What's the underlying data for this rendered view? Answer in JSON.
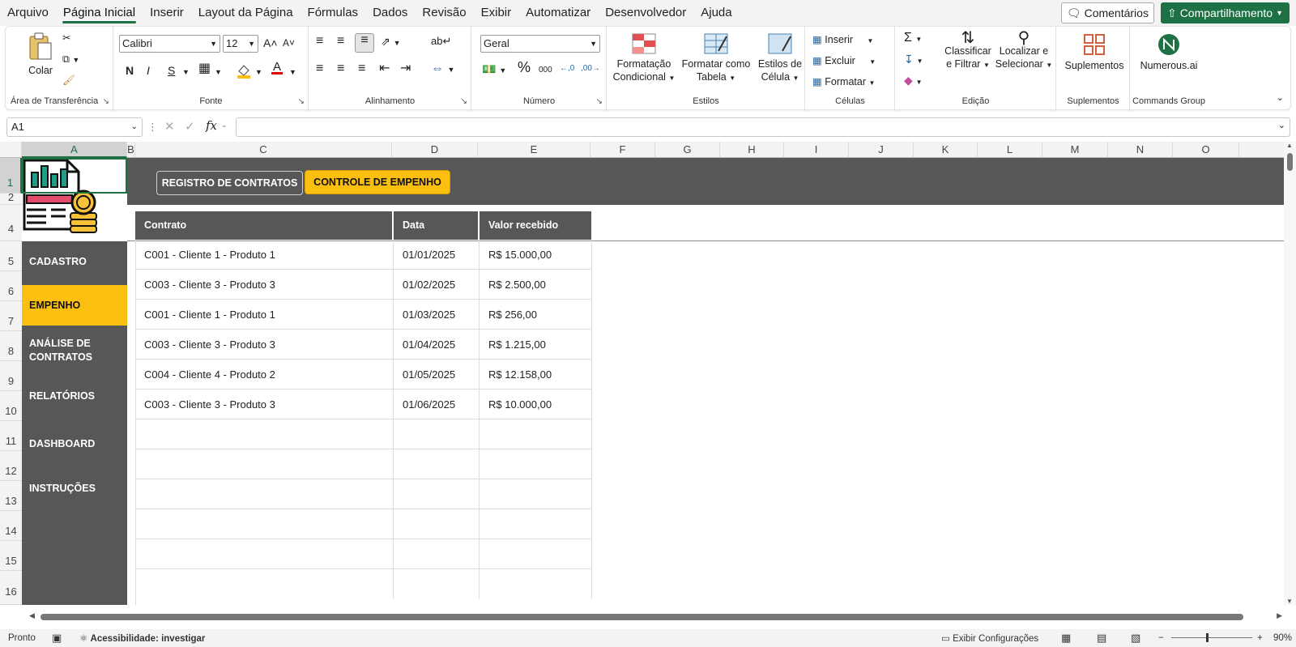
{
  "menu": {
    "tabs": [
      "Arquivo",
      "Página Inicial",
      "Inserir",
      "Layout da Página",
      "Fórmulas",
      "Dados",
      "Revisão",
      "Exibir",
      "Automatizar",
      "Desenvolvedor",
      "Ajuda"
    ],
    "active_index": 1,
    "comments_label": "Comentários",
    "share_label": "Compartilhamento"
  },
  "ribbon": {
    "clipboard": {
      "paste_label": "Colar",
      "group_label": "Área de Transferência"
    },
    "font": {
      "name": "Calibri",
      "size": "12",
      "bold": "N",
      "italic": "I",
      "underline": "S",
      "group_label": "Fonte"
    },
    "alignment": {
      "group_label": "Alinhamento"
    },
    "number": {
      "format": "Geral",
      "group_label": "Número"
    },
    "styles": {
      "conditional_l1": "Formatação",
      "conditional_l2": "Condicional",
      "table_l1": "Formatar como",
      "table_l2": "Tabela",
      "cell_l1": "Estilos de",
      "cell_l2": "Célula",
      "group_label": "Estilos"
    },
    "cells": {
      "insert": "Inserir",
      "delete": "Excluir",
      "format": "Formatar",
      "group_label": "Células"
    },
    "editing": {
      "sort_l1": "Classificar",
      "sort_l2": "e Filtrar",
      "find_l1": "Localizar e",
      "find_l2": "Selecionar",
      "group_label": "Edição"
    },
    "addins": {
      "label": "Suplementos",
      "group_label": "Suplementos"
    },
    "commands": {
      "label": "Numerous.ai",
      "group_label": "Commands Group"
    }
  },
  "formula_bar": {
    "name_box": "A1",
    "fx": "fx",
    "value": ""
  },
  "columns": [
    "A",
    "B",
    "C",
    "D",
    "E",
    "F",
    "G",
    "H",
    "I",
    "J",
    "K",
    "L",
    "M",
    "N",
    "O"
  ],
  "rows": [
    "1",
    "2",
    "4",
    "5",
    "6",
    "7",
    "8",
    "9",
    "10",
    "11",
    "12",
    "13",
    "14",
    "15",
    "16"
  ],
  "sheet": {
    "buttons": {
      "registro": "REGISTRO DE CONTRATOS",
      "controle": "CONTROLE DE EMPENHO"
    },
    "nav": [
      {
        "label": "CADASTRO"
      },
      {
        "label": "EMPENHO"
      },
      {
        "label": "ANÁLISE DE CONTRATOS"
      },
      {
        "label": "RELATÓRIOS"
      },
      {
        "label": "DASHBOARD"
      },
      {
        "label": "INSTRUÇÕES"
      }
    ],
    "table": {
      "headers": [
        "Contrato",
        "Data",
        "Valor recebido"
      ],
      "rows": [
        [
          "C001 - Cliente 1 - Produto 1",
          "01/01/2025",
          "R$ 15.000,00"
        ],
        [
          "C003 - Cliente 3 - Produto 3",
          "01/02/2025",
          "R$ 2.500,00"
        ],
        [
          "C001 - Cliente 1 - Produto 1",
          "01/03/2025",
          "R$ 256,00"
        ],
        [
          "C003 - Cliente 3 - Produto 3",
          "01/04/2025",
          "R$ 1.215,00"
        ],
        [
          "C004 - Cliente 4 - Produto 2",
          "01/05/2025",
          "R$ 12.158,00"
        ],
        [
          "C003 - Cliente 3 - Produto 3",
          "01/06/2025",
          "R$ 10.000,00"
        ]
      ]
    }
  },
  "status": {
    "ready": "Pronto",
    "accessibility": "Acessibilidade: investigar",
    "display_settings": "Exibir Configurações",
    "zoom": "90%"
  },
  "colors": {
    "accent": "#1e7145",
    "nav_active": "#fbbf0f",
    "nav_bg": "#575757"
  }
}
